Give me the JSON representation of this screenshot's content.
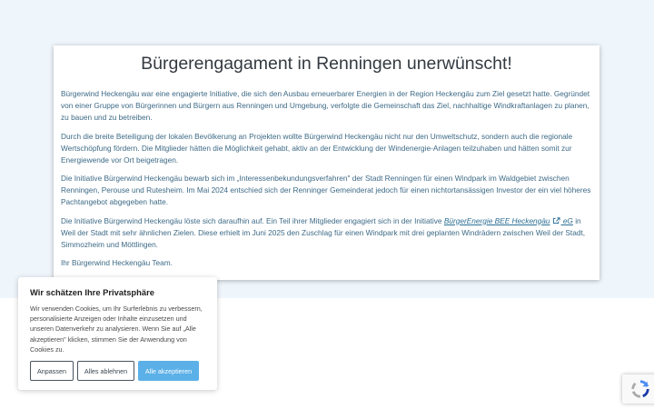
{
  "article": {
    "title": "Bürgerengagament in Renningen unerwünscht!",
    "p1": "Bürgerwind Heckengäu war eine engagierte Initiative, die sich den Ausbau erneuerbarer Energien in der Region Heckengäu zum Ziel gesetzt hatte. Gegründet von einer Gruppe von Bürgerinnen und Bürgern aus Renningen und Umgebung, verfolgte die Gemeinschaft das Ziel, nachhaltige Windkraftanlagen zu planen, zu bauen und zu betreiben.",
    "p2": "Durch die breite Beteiligung der lokalen Bevölkerung an Projekten wollte Bürgerwind Heckengäu nicht nur den Umweltschutz, sondern auch die regionale Wertschöpfung fördern. Die Mitglieder hätten die Möglichkeit gehabt, aktiv an der Entwicklung der Windenergie-Anlagen teilzuhaben und hätten somit zur Energiewende vor Ort beigetragen.",
    "p3": "Die Initiative Bürgerwind Heckengäu bewarb sich im „Interessenbekundungsverfahren\" der Stadt Renningen für einen Windpark im Waldgebiet zwischen Renningen, Perouse und Rutesheim. Im Mai 2024 entschied sich der Renninger Gemeinderat jedoch für einen nichtortansässigen Investor der ein viel höheres Pachtangebot abgegeben hatte.",
    "p4_before": "Die Initiative Bürgerwind Heckengäu löste sich daraufhin auf. Ein Teil ihrer Mitglieder engagiert sich in der Initiative ",
    "p4_link": "BürgerEnergie BEE Heckengäu",
    "p4_link_suffix": " eG",
    "p4_after": " in Weil der Stadt mit sehr ähnlichen Zielen. Diese erhielt im Juni 2025 den Zuschlag für einen Windpark mit drei geplanten Windrädern zwischen Weil der Stadt, Simmozheim und Möttlingen.",
    "p5": "Ihr Bürgerwind Heckengäu Team."
  },
  "cookie": {
    "title": "Wir schätzen Ihre Privatsphäre",
    "text": "Wir verwenden Cookies, um Ihr Surferlebnis zu verbessern, personalisierte Anzeigen oder Inhalte einzusetzen und unseren Datenverkehr zu analysieren. Wenn Sie auf „Alle akzeptieren\" klicken, stimmen Sie der Anwendung von Cookies zu.",
    "customize_label": "Anpassen",
    "reject_label": "Alles ablehnen",
    "accept_label": "Alle akzeptieren"
  },
  "colors": {
    "accent": "#5bb0e8",
    "body_text": "#3d6a86",
    "page_background": "#eef5fb"
  },
  "icons": {
    "external_link": "external-link-icon",
    "recaptcha": "recaptcha-icon"
  }
}
